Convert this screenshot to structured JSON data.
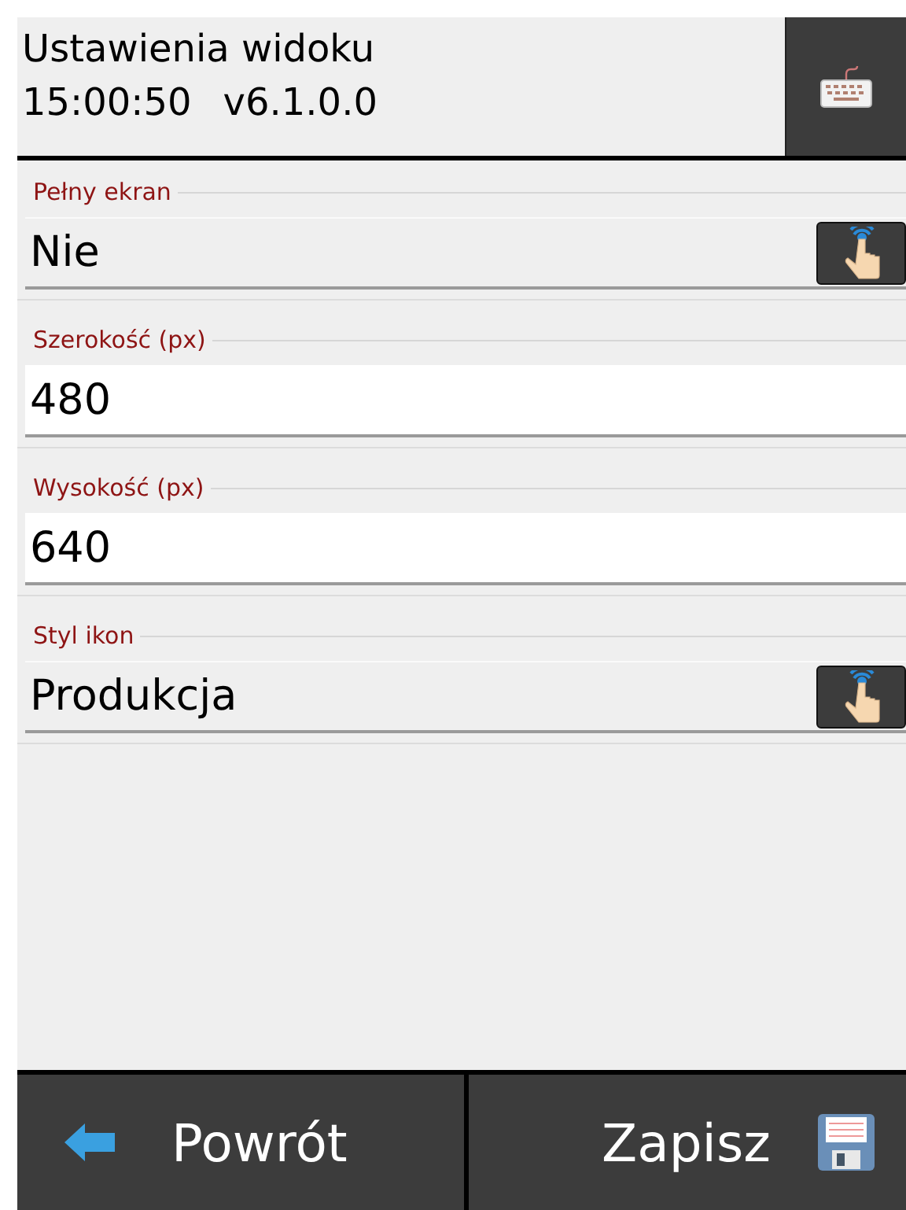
{
  "header": {
    "title": "Ustawienia widoku",
    "time": "15:00:50",
    "version": "v6.1.0.0"
  },
  "fields": [
    {
      "label": "Pełny ekran",
      "value": "Nie",
      "kind": "select"
    },
    {
      "label": "Szerokość (px)",
      "value": "480",
      "kind": "input"
    },
    {
      "label": "Wysokość (px)",
      "value": "640",
      "kind": "input"
    },
    {
      "label": "Styl ikon",
      "value": "Produkcja",
      "kind": "select"
    }
  ],
  "footer": {
    "back": "Powrót",
    "save": "Zapisz"
  }
}
